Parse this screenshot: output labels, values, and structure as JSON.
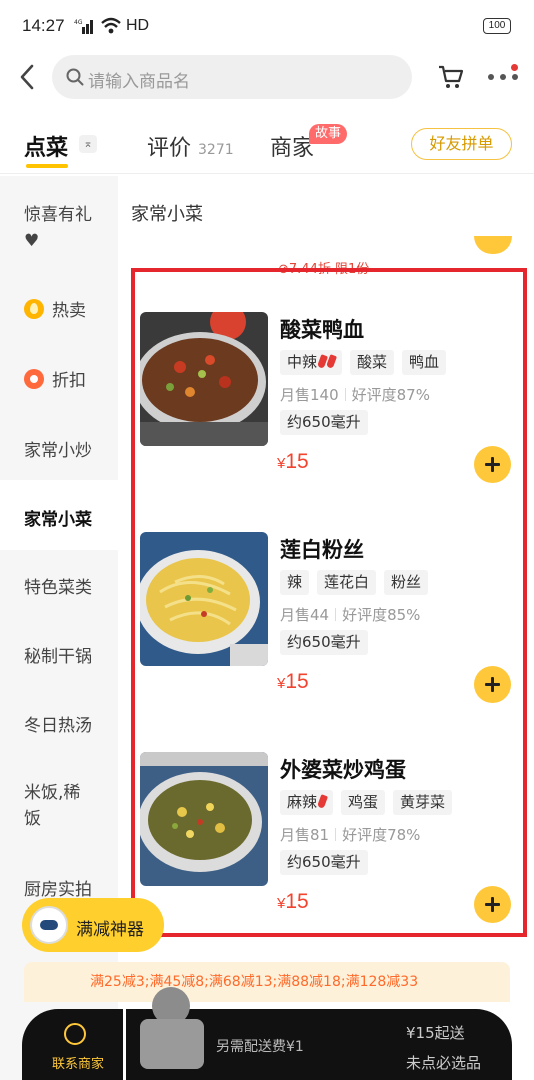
{
  "status_bar": {
    "time": "14:27",
    "network": "4G",
    "hd": "HD",
    "battery": "100"
  },
  "header": {
    "search_placeholder": "请输入商品名",
    "icons": [
      "back-arrow-icon",
      "search-icon",
      "cart-icon",
      "more-icon"
    ]
  },
  "tabs": {
    "order": "点菜",
    "review": "评价",
    "review_count": "3271",
    "merchant": "商家",
    "merchant_badge": "故事",
    "friend_group": "好友拼单"
  },
  "sidebar": {
    "items": [
      {
        "label": "惊喜有礼",
        "extra": "♥"
      },
      {
        "label": "热卖"
      },
      {
        "label": "折扣"
      },
      {
        "label": "家常小炒"
      },
      {
        "label": "家常小菜",
        "active": true
      },
      {
        "label": "特色菜类"
      },
      {
        "label": "秘制干锅"
      },
      {
        "label": "冬日热汤"
      },
      {
        "label": "米饭,稀"
      },
      {
        "label": "饭"
      },
      {
        "label": "厨房实拍"
      }
    ]
  },
  "section_title": "家常小菜",
  "promo_peek": "⊘7.44折 限1份",
  "dishes": [
    {
      "name": "酸菜鸭血",
      "tags": [
        "中辣",
        "酸菜",
        "鸭血"
      ],
      "monthly_sales": "月售140",
      "rating": "好评度87%",
      "volume": "约650毫升",
      "currency": "¥",
      "price": "15"
    },
    {
      "name": "莲白粉丝",
      "tags": [
        "辣",
        "莲花白",
        "粉丝"
      ],
      "monthly_sales": "月售44",
      "rating": "好评度85%",
      "volume": "约650毫升",
      "currency": "¥",
      "price": "15"
    },
    {
      "name": "外婆菜炒鸡蛋",
      "tags": [
        "麻辣",
        "鸡蛋",
        "黄芽菜"
      ],
      "monthly_sales": "月售81",
      "rating": "好评度78%",
      "volume": "约650毫升",
      "currency": "¥",
      "price": "15"
    }
  ],
  "discount_robot": "满减神器",
  "promo_bar": "满25减3;满45减8;满68减13;满88减18;满128减33",
  "bottom_bar": {
    "contact": "联系商家",
    "delivery_fee": "另需配送费¥1",
    "min_order": "¥15起送",
    "must_pick": "未点必选品"
  },
  "colors": {
    "accent_yellow": "#ffc83a",
    "price_red": "#f2432f",
    "highlight_red": "#e5262d"
  }
}
